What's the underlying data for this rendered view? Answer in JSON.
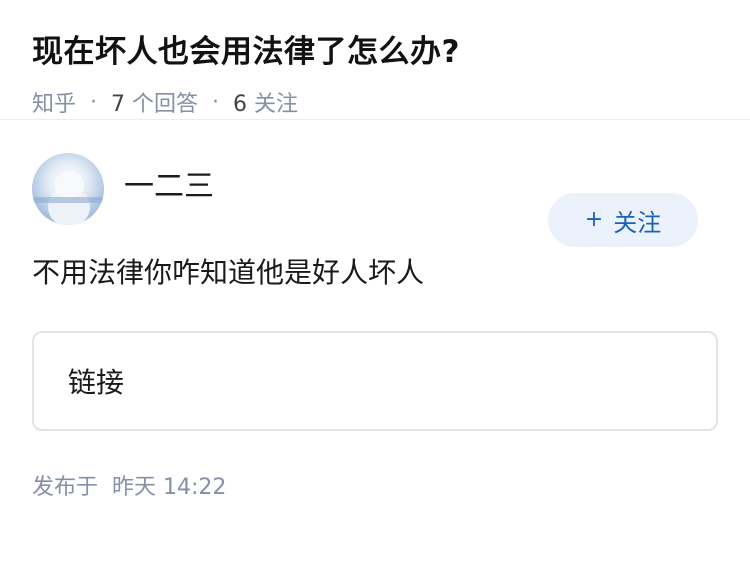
{
  "question": {
    "title": "现在坏人也会用法律了怎么办?",
    "source": "知乎",
    "answer_count": "7",
    "answer_label": "个回答",
    "follower_count": "6",
    "follower_label": "关注",
    "separator": "·"
  },
  "answer": {
    "author": {
      "name": "一二三",
      "avatar": "avatar-image"
    },
    "follow_button": {
      "icon": "plus-icon",
      "icon_glyph": "+",
      "label": "关注"
    },
    "content": "不用法律你咋知道他是好人坏人",
    "link_card_label": "链接",
    "publish": {
      "prefix": "发布于",
      "time": "昨天 14:22"
    }
  }
}
